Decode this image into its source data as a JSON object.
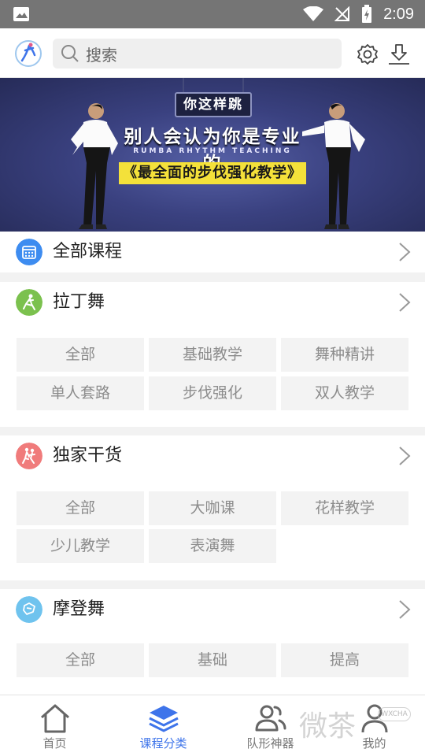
{
  "status_bar": {
    "time": "2:09"
  },
  "header": {
    "search_placeholder": "搜索",
    "icons": [
      "app-logo-icon",
      "search-icon",
      "settings-icon",
      "download-icon"
    ]
  },
  "banner": {
    "sign": "你这样跳",
    "headline": "别人会认为你是专业的",
    "subtitle": "RUMBA RHYTHM TEACHING",
    "highlight": "《最全面的步伐强化教学》"
  },
  "sections": [
    {
      "title": "全部课程",
      "icon": "calendar-icon",
      "icon_color": "#3d8cf0",
      "tags": []
    },
    {
      "title": "拉丁舞",
      "icon": "latin-dancer-icon",
      "icon_color": "#7bc14e",
      "tags": [
        "全部",
        "基础教学",
        "舞种精讲",
        "单人套路",
        "步伐强化",
        "双人教学"
      ]
    },
    {
      "title": "独家干货",
      "icon": "dancing-couple-icon",
      "icon_color": "#f07b7b",
      "tags": [
        "全部",
        "大咖课",
        "花样教学",
        "少儿教学",
        "表演舞"
      ]
    },
    {
      "title": "摩登舞",
      "icon": "ballroom-icon",
      "icon_color": "#6fc3ee",
      "tags": [
        "全部",
        "基础",
        "提高"
      ]
    }
  ],
  "bottom_nav": {
    "active_index": 1,
    "items": [
      {
        "label": "首页",
        "icon": "home-icon"
      },
      {
        "label": "课程分类",
        "icon": "layers-icon"
      },
      {
        "label": "队形神器",
        "icon": "formation-icon"
      },
      {
        "label": "我的",
        "icon": "profile-icon"
      }
    ]
  },
  "watermark": {
    "text": "微茶",
    "badge": "WXCHA"
  },
  "colors": {
    "accent": "#3e74ea",
    "status_bar": "#757575",
    "tag_bg": "#f3f3f3"
  }
}
